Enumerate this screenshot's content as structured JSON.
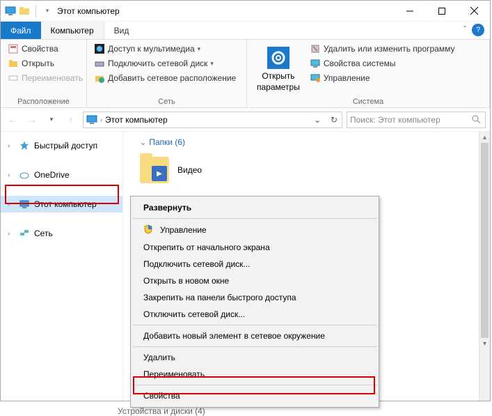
{
  "titlebar": {
    "title": "Этот компьютер"
  },
  "menu": {
    "file": "Файл",
    "computer": "Компьютер",
    "view": "Вид"
  },
  "ribbon": {
    "group_location": "Расположение",
    "group_network": "Сеть",
    "group_system": "Система",
    "properties": "Свойства",
    "open": "Открыть",
    "rename": "Переименовать",
    "media_access": "Доступ к мультимедиа",
    "map_drive": "Подключить сетевой диск",
    "add_netloc": "Добавить сетевое расположение",
    "open_settings_l1": "Открыть",
    "open_settings_l2": "параметры",
    "uninstall": "Удалить или изменить программу",
    "sys_props": "Свойства системы",
    "manage": "Управление"
  },
  "address": {
    "text": "Этот компьютер"
  },
  "search": {
    "placeholder": "Поиск: Этот компьютер"
  },
  "sidebar": {
    "quick": "Быстрый доступ",
    "onedrive": "OneDrive",
    "thispc": "Этот компьютер",
    "network": "Сеть"
  },
  "main": {
    "folders_header": "Папки (6)",
    "video": "Видео",
    "devices": "Устройства и диски (4)"
  },
  "ctx": {
    "expand": "Развернуть",
    "manage": "Управление",
    "unpin_start": "Открепить от начального экрана",
    "map_drive": "Подключить сетевой диск...",
    "open_new": "Открыть в новом окне",
    "pin_quick": "Закрепить на панели быстрого доступа",
    "disconnect": "Отключить сетевой диск...",
    "add_net": "Добавить новый элемент в сетевое окружение",
    "delete": "Удалить",
    "rename": "Переименовать",
    "properties": "Свойства"
  }
}
